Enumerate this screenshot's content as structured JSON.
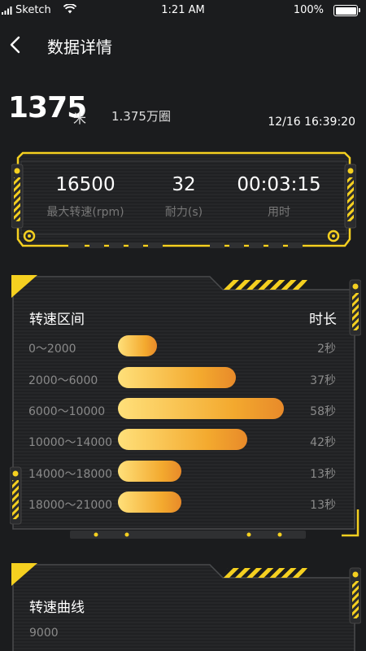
{
  "status_bar": {
    "carrier": "Sketch",
    "time": "1:21 AM",
    "battery": "100%"
  },
  "nav": {
    "title": "数据详情",
    "back_icon": "chevron-left-icon"
  },
  "summary": {
    "distance": "1375",
    "distance_unit": "米",
    "laps": "1.375万圈",
    "datetime": "12/16 16:39:20"
  },
  "stats": [
    {
      "value": "16500",
      "label": "最大转速(rpm)"
    },
    {
      "value": "32",
      "label": "耐力(s)"
    },
    {
      "value": "00:03:15",
      "label": "用时"
    }
  ],
  "speed_range": {
    "header_left": "转速区间",
    "header_right": "时长",
    "max_seconds": 58,
    "rows": [
      {
        "range": "0～2000",
        "seconds": 2,
        "duration": "2秒"
      },
      {
        "range": "2000～6000",
        "seconds": 37,
        "duration": "37秒"
      },
      {
        "range": "6000～10000",
        "seconds": 58,
        "duration": "58秒"
      },
      {
        "range": "10000～14000",
        "seconds": 42,
        "duration": "42秒"
      },
      {
        "range": "14000～18000",
        "seconds": 13,
        "duration": "13秒"
      },
      {
        "range": "18000～21000",
        "seconds": 13,
        "duration": "13秒"
      }
    ]
  },
  "speed_curve": {
    "title": "转速曲线",
    "y_tick_top": "9000"
  },
  "colors": {
    "accent_yellow": "#f5d020",
    "background": "#1b1c1e",
    "card": "#232426",
    "bar_start": "#ffe07a",
    "bar_end": "#e88a2a",
    "muted_text": "#8a8a8a"
  }
}
